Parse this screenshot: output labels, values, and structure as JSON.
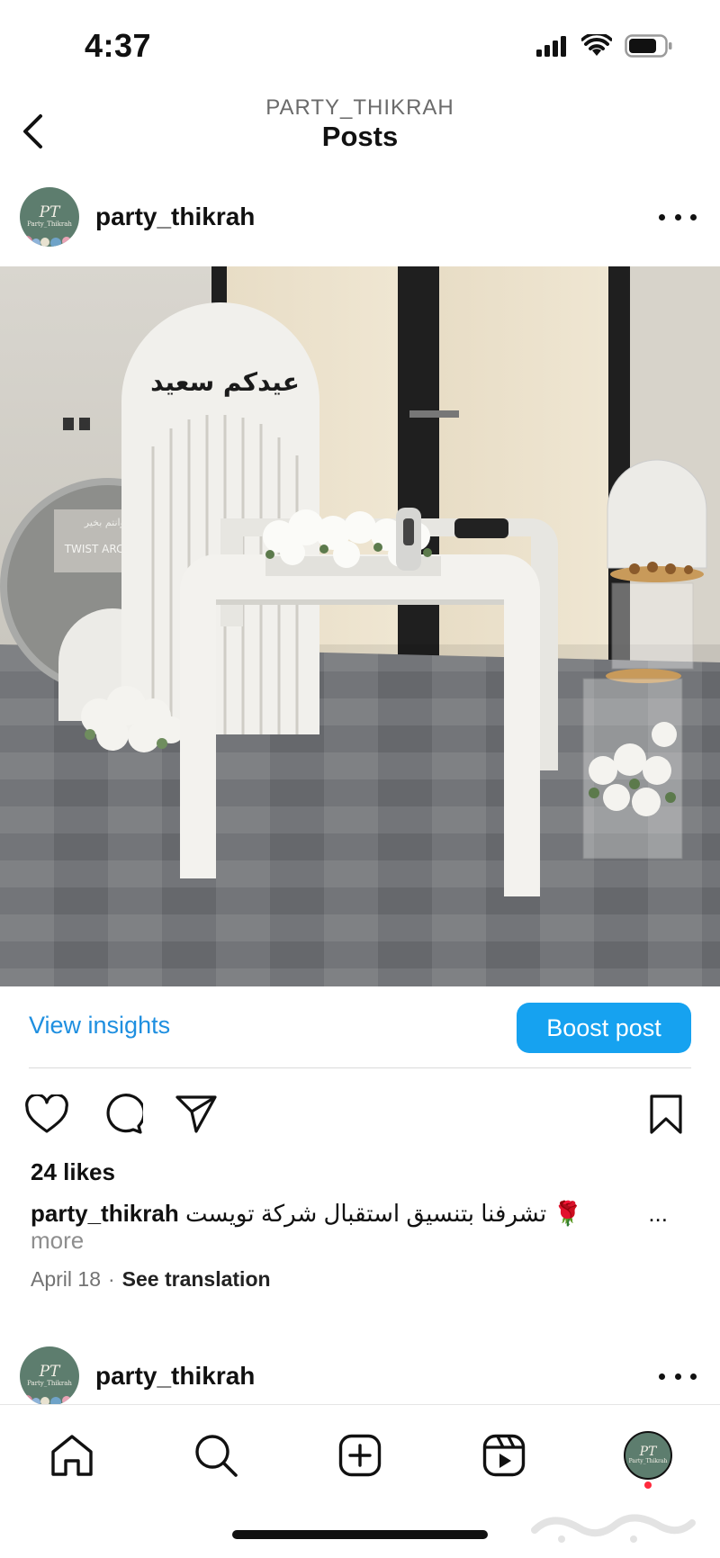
{
  "status_bar": {
    "time": "4:37"
  },
  "header": {
    "account": "PARTY_THIKRAH",
    "title": "Posts"
  },
  "post": {
    "username": "party_thikrah",
    "avatar": {
      "monogram": "PT",
      "brand": "Party_Thikrah"
    },
    "image": {
      "sign_text": "عيدكم سعيد",
      "wall_sign_text": "TWIST ARCHITECTS",
      "wall_sign_arabic": "كل عام وانتم بخير"
    },
    "insights_label": "View insights",
    "boost_label": "Boost post",
    "likes": "24 likes",
    "caption_user": "party_thikrah",
    "caption_text": "تشرفنا بتنسيق استقبال شركة تويست 🌹",
    "caption_ellipsis": "...",
    "more_label": "more",
    "date": "April 18",
    "separator": "·",
    "see_translation": "See translation"
  },
  "next_post": {
    "username": "party_thikrah"
  },
  "icons": {
    "back": "chevron-left-icon",
    "more": "ellipsis-icon",
    "like": "heart-icon",
    "comment": "comment-icon",
    "share": "paper-plane-icon",
    "save": "bookmark-icon",
    "nav": [
      "home-icon",
      "search-icon",
      "create-icon",
      "reels-icon",
      "profile-avatar"
    ]
  },
  "colors": {
    "link_blue": "#1e8fe0",
    "boost_blue": "#16a2f0",
    "avatar_green": "#5d7d6e",
    "notification_red": "#ff2a3d"
  }
}
